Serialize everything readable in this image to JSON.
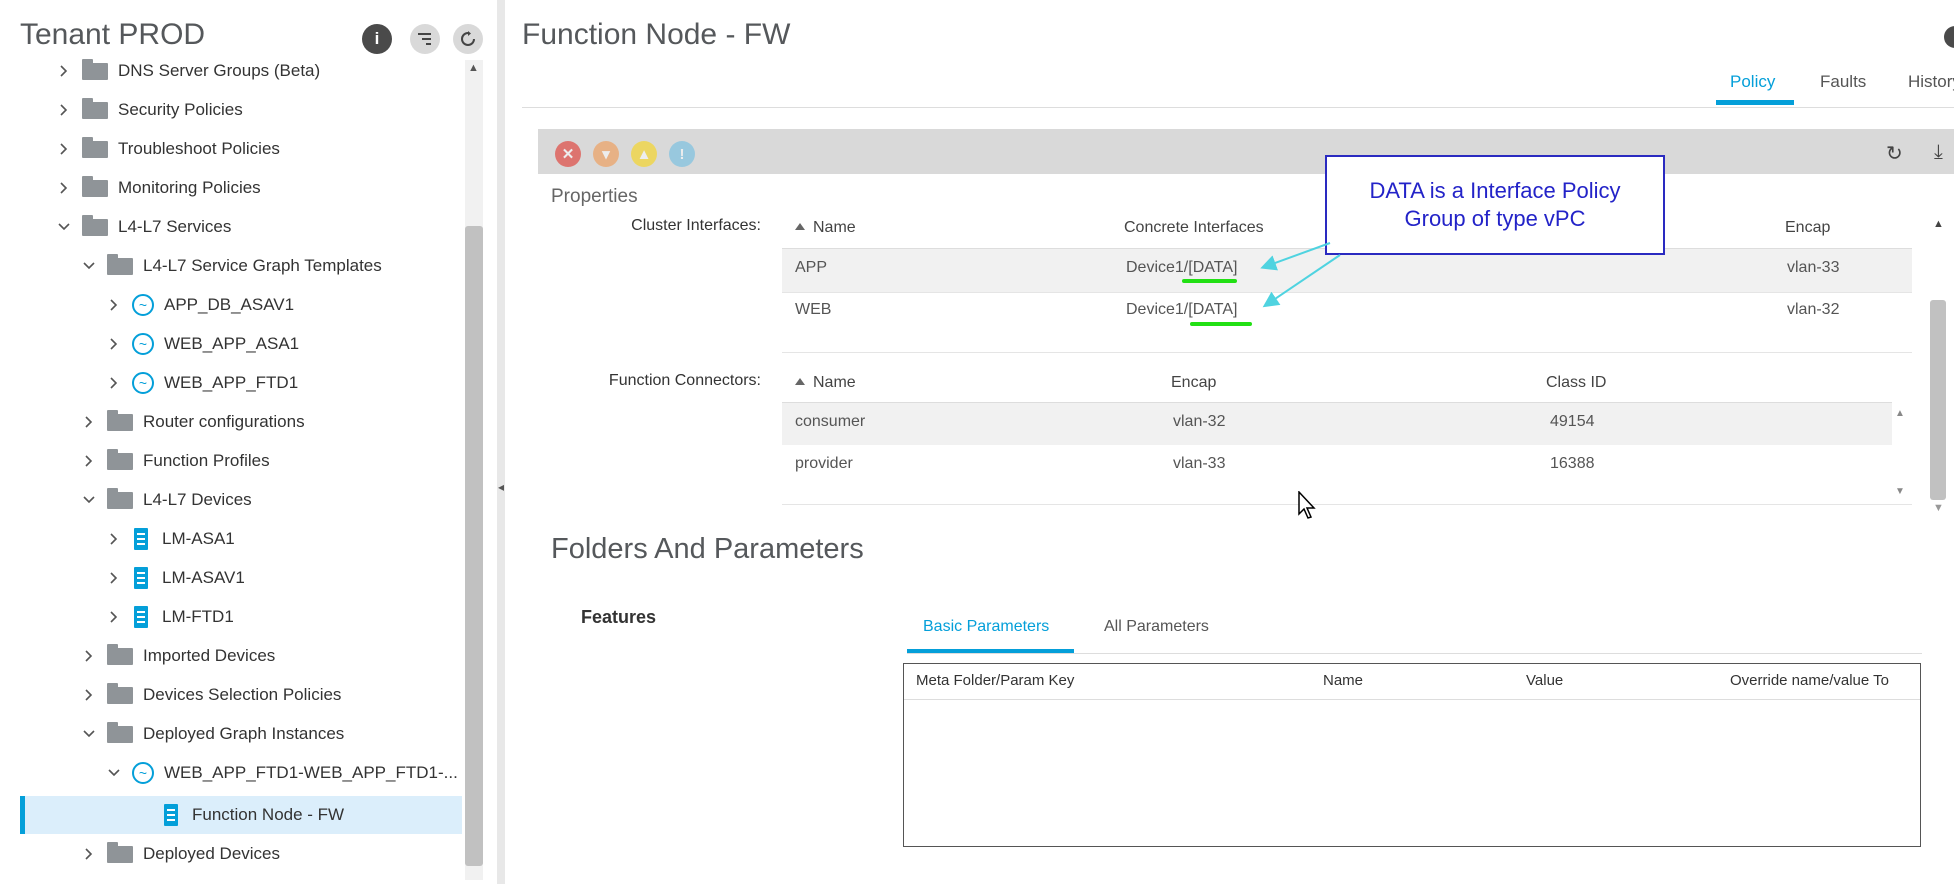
{
  "left_panel": {
    "title": "Tenant PROD",
    "tree": [
      {
        "label": "DNS Server Groups (Beta)",
        "icon": "folder-icon",
        "expanded": false
      },
      {
        "label": "Security Policies",
        "icon": "folder-icon",
        "expanded": false
      },
      {
        "label": "Troubleshoot Policies",
        "icon": "folder-icon",
        "expanded": false
      },
      {
        "label": "Monitoring Policies",
        "icon": "folder-icon",
        "expanded": false
      },
      {
        "label": "L4-L7 Services",
        "icon": "folder-icon",
        "expanded": true
      },
      {
        "label": "L4-L7 Service Graph Templates",
        "icon": "folder-icon",
        "expanded": true
      },
      {
        "label": "APP_DB_ASAV1",
        "icon": "service-graph-icon",
        "expanded": false
      },
      {
        "label": "WEB_APP_ASA1",
        "icon": "service-graph-icon",
        "expanded": false
      },
      {
        "label": "WEB_APP_FTD1",
        "icon": "service-graph-icon",
        "expanded": false
      },
      {
        "label": "Router configurations",
        "icon": "folder-icon",
        "expanded": false
      },
      {
        "label": "Function Profiles",
        "icon": "folder-icon",
        "expanded": false
      },
      {
        "label": "L4-L7 Devices",
        "icon": "folder-icon",
        "expanded": true
      },
      {
        "label": "LM-ASA1",
        "icon": "device-icon",
        "expanded": false
      },
      {
        "label": "LM-ASAV1",
        "icon": "device-icon",
        "expanded": false
      },
      {
        "label": "LM-FTD1",
        "icon": "device-icon",
        "expanded": false
      },
      {
        "label": "Imported Devices",
        "icon": "folder-icon",
        "expanded": false
      },
      {
        "label": "Devices Selection Policies",
        "icon": "folder-icon",
        "expanded": false
      },
      {
        "label": "Deployed Graph Instances",
        "icon": "folder-icon",
        "expanded": true
      },
      {
        "label": "WEB_APP_FTD1-WEB_APP_FTD1-...",
        "icon": "service-graph-icon",
        "expanded": true
      },
      {
        "label": "Function Node - FW",
        "icon": "device-icon",
        "expanded": false,
        "selected": true
      },
      {
        "label": "Deployed Devices",
        "icon": "folder-icon",
        "expanded": false
      }
    ]
  },
  "main": {
    "title": "Function Node - FW",
    "tabs": [
      "Policy",
      "Faults",
      "History"
    ],
    "active_tab": "Policy",
    "properties_label": "Properties",
    "cluster_interfaces": {
      "label": "Cluster Interfaces:",
      "columns": [
        "Name",
        "Concrete Interfaces",
        "Encap"
      ],
      "rows": [
        {
          "name": "APP",
          "concrete": "Device1/[DATA]",
          "encap": "vlan-33"
        },
        {
          "name": "WEB",
          "concrete": "Device1/[DATA]",
          "encap": "vlan-32"
        }
      ]
    },
    "function_connectors": {
      "label": "Function Connectors:",
      "columns": [
        "Name",
        "Encap",
        "Class ID"
      ],
      "rows": [
        {
          "name": "consumer",
          "encap": "vlan-32",
          "class_id": "49154"
        },
        {
          "name": "provider",
          "encap": "vlan-33",
          "class_id": "16388"
        }
      ]
    },
    "callout": "DATA is a Interface Policy Group of type vPC",
    "folders_title": "Folders And Parameters",
    "features_label": "Features",
    "param_tabs": [
      "Basic Parameters",
      "All Parameters"
    ],
    "param_columns": [
      "Meta Folder/Param Key",
      "Name",
      "Value",
      "Override name/value To"
    ]
  },
  "colors": {
    "accent": "#049fd9",
    "callout_border": "#2a2ac0",
    "callout_text": "#2323c8",
    "highlight_underline": "#22e014",
    "arrow": "#4fd3e0"
  }
}
